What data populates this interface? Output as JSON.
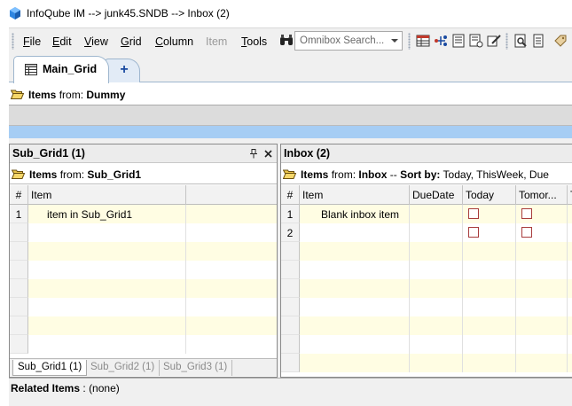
{
  "window": {
    "title": "InfoQube IM --> junk45.SNDB --> Inbox (2)"
  },
  "menu": {
    "items": [
      {
        "prefix": "",
        "u": "F",
        "rest": "ile",
        "disabled": false
      },
      {
        "prefix": "",
        "u": "E",
        "rest": "dit",
        "disabled": false
      },
      {
        "prefix": "",
        "u": "V",
        "rest": "iew",
        "disabled": false
      },
      {
        "prefix": "",
        "u": "G",
        "rest": "rid",
        "disabled": false
      },
      {
        "prefix": "",
        "u": "C",
        "rest": "olumn",
        "disabled": false
      },
      {
        "prefix": "Item",
        "u": "",
        "rest": "",
        "disabled": true
      },
      {
        "prefix": "",
        "u": "T",
        "rest": "ools",
        "disabled": false
      }
    ],
    "omnibox_placeholder": "Omnibox Search...",
    "toolbar_icons": [
      "grid-view-icon",
      "hierarchy-icon",
      "properties-icon",
      "filter-icon",
      "edit-icon",
      "preview-icon",
      "document-icon",
      "tag-icon"
    ]
  },
  "tabs": {
    "main": "Main_Grid",
    "add": "+"
  },
  "top_grid": {
    "items_from_label": "Items",
    "from_word": "from:",
    "source": "Dummy"
  },
  "left_pane": {
    "title": "Sub_Grid1 (1)",
    "pin_icon": "pin-icon",
    "close_icon": "close-icon",
    "items_from_label": "Items",
    "from_word": "from:",
    "source": "Sub_Grid1",
    "columns": [
      "#",
      "Item"
    ],
    "rows": [
      {
        "num": "1",
        "item": "item in Sub_Grid1"
      }
    ],
    "tabs": [
      "Sub_Grid1 (1)",
      "Sub_Grid2 (1)",
      "Sub_Grid3 (1)"
    ]
  },
  "right_pane": {
    "title": "Inbox (2)",
    "items_from_label": "Items",
    "from_word": "from:",
    "source": "Inbox",
    "separator": "--",
    "sort_label": "Sort by:",
    "sort_value": "Today, ThisWeek, Due",
    "columns": [
      "#",
      "Item",
      "DueDate",
      "Today",
      "Tomor...",
      "T"
    ],
    "rows": [
      {
        "num": "1",
        "item": "Blank inbox item",
        "today": false,
        "tomorrow": false
      },
      {
        "num": "2",
        "item": "",
        "today": false,
        "tomorrow": false
      }
    ]
  },
  "related": {
    "label": "Related Items",
    "colon": ":",
    "value": "(none)"
  }
}
